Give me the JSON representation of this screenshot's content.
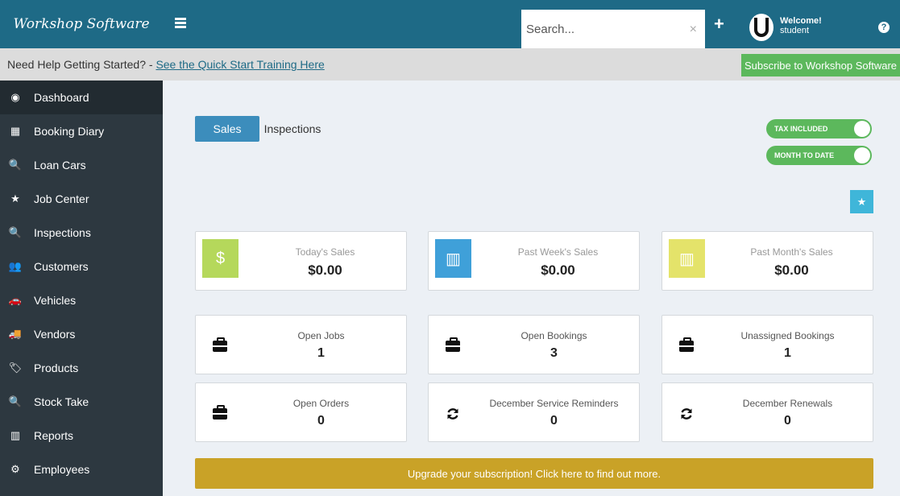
{
  "header": {
    "brand": "Workshop Software",
    "search_placeholder": "Search...",
    "clear_symbol": "×",
    "plus_symbol": "+",
    "welcome": "Welcome!",
    "username": "student",
    "help_symbol": "?"
  },
  "helpbar": {
    "prefix": "Need Help Getting Started? - ",
    "link": "See the Quick Start Training Here",
    "subscribe": "Subscribe to Workshop Software"
  },
  "sidebar": {
    "items": [
      {
        "label": "Dashboard",
        "icon": "dashboard-icon",
        "glyph": "◉"
      },
      {
        "label": "Booking Diary",
        "icon": "calendar-icon",
        "glyph": "▦"
      },
      {
        "label": "Loan Cars",
        "icon": "search-icon",
        "glyph": "🔍"
      },
      {
        "label": "Job Center",
        "icon": "star-icon",
        "glyph": "★"
      },
      {
        "label": "Inspections",
        "icon": "search-icon",
        "glyph": "🔍"
      },
      {
        "label": "Customers",
        "icon": "users-icon",
        "glyph": "👥"
      },
      {
        "label": "Vehicles",
        "icon": "car-icon",
        "glyph": "🚗"
      },
      {
        "label": "Vendors",
        "icon": "truck-icon",
        "glyph": "🚚"
      },
      {
        "label": "Products",
        "icon": "tag-icon",
        "glyph": "🏷"
      },
      {
        "label": "Stock Take",
        "icon": "search-icon",
        "glyph": "🔍"
      },
      {
        "label": "Reports",
        "icon": "bar-chart-icon",
        "glyph": "▥"
      },
      {
        "label": "Employees",
        "icon": "cogs-icon",
        "glyph": "⚙"
      }
    ]
  },
  "tabs": {
    "sales": "Sales",
    "inspections": "Inspections"
  },
  "toggles": {
    "tax": "TAX INCLUDED",
    "period": "MONTH TO DATE"
  },
  "stats": [
    {
      "title": "Today's Sales",
      "value": "$0.00",
      "color": "#b5d85b",
      "icon": "dollar-icon",
      "glyph": "$"
    },
    {
      "title": "Past Week's Sales",
      "value": "$0.00",
      "color": "#3fa0d9",
      "icon": "bar-chart-icon",
      "glyph": "▥"
    },
    {
      "title": "Past Month's Sales",
      "value": "$0.00",
      "color": "#e4e36a",
      "icon": "bar-chart-icon",
      "glyph": "▥"
    }
  ],
  "counts": [
    {
      "title": "Open Jobs",
      "value": "1",
      "icon": "briefcase-icon"
    },
    {
      "title": "Open Bookings",
      "value": "3",
      "icon": "briefcase-icon"
    },
    {
      "title": "Unassigned Bookings",
      "value": "1",
      "icon": "briefcase-icon"
    },
    {
      "title": "Open Orders",
      "value": "0",
      "icon": "briefcase-icon"
    },
    {
      "title": "December Service Reminders",
      "value": "0",
      "icon": "refresh-icon"
    },
    {
      "title": "December Renewals",
      "value": "0",
      "icon": "refresh-icon"
    }
  ],
  "star_symbol": "★",
  "upgrade": "Upgrade your subscription! Click here to find out more."
}
